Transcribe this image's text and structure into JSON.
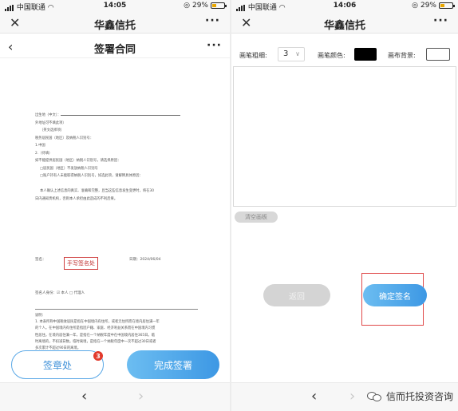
{
  "status_left": {
    "carrier": "中国联通",
    "time": "14:05",
    "battery": "29%",
    "battery_level": 0.29
  },
  "status_right": {
    "carrier": "中国联通",
    "time": "14:06",
    "battery": "29%",
    "battery_level": 0.29
  },
  "left_screen": {
    "window_title": "华鑫信托",
    "page_title": "签署合同",
    "contract_lines": [
      "出生地（中文）：",
      "外地址可不填此项）",
      "（英文选择项）",
      "税务居民国（地区）及纳税人识别号：",
      "1.中国",
      "2.（待填）",
      "如不能提供居民国（地区）纳税人识别号，请选择原因：",
      "□居民国（地区）不发放纳税人识别号",
      "□账户持有人未能取得纳税人识别号，如选此项，请解释具体原因：",
      "本人确认上述信息的真实、准确和完整，且当这些信息发生变更时，将在30",
      "日内通知贵机构，否则本人承担由此造成的不利后果。"
    ],
    "signature_label": "签名：",
    "signature_stamp": "手写签名处",
    "date_label": "日期：2024/06/04",
    "signer_identity": "签名人身份：☑ 本人    □ 代理人",
    "notes_title": "说明：",
    "notes_lines": [
      "1. 本表所称中国税收居民是指在中国境内有住所，或者无住所而在境内居住满一年",
      "的个人。在中国境内有住所是指因户籍、家庭、经济利益关系而在中国境内习惯",
      "性居住。在境内居住满一年，是指在一个纳税年度中在中国境内居住365日。临",
      "时离境的，不扣减日数。临时离境，是指在一个纳税年度中一次不超过30日或者",
      "多次累计不超过90日的离境。"
    ],
    "seal_button": "签章处",
    "seal_badge": "3",
    "finish_button": "完成签署"
  },
  "right_screen": {
    "window_title": "华鑫信托",
    "brush_size_label": "画笔粗细:",
    "brush_size_value": "3",
    "brush_color_label": "画笔颜色:",
    "brush_color": "#000000",
    "canvas_bg_label": "画布背景:",
    "canvas_bg": "#ffffff",
    "clear_button": "清空画板",
    "return_button": "返回",
    "confirm_button": "确定签名",
    "watermark": "信而托投资咨询"
  },
  "colors": {
    "accent": "#3d98e4",
    "highlight_frame": "#e04848",
    "badge": "#e23a2c"
  }
}
